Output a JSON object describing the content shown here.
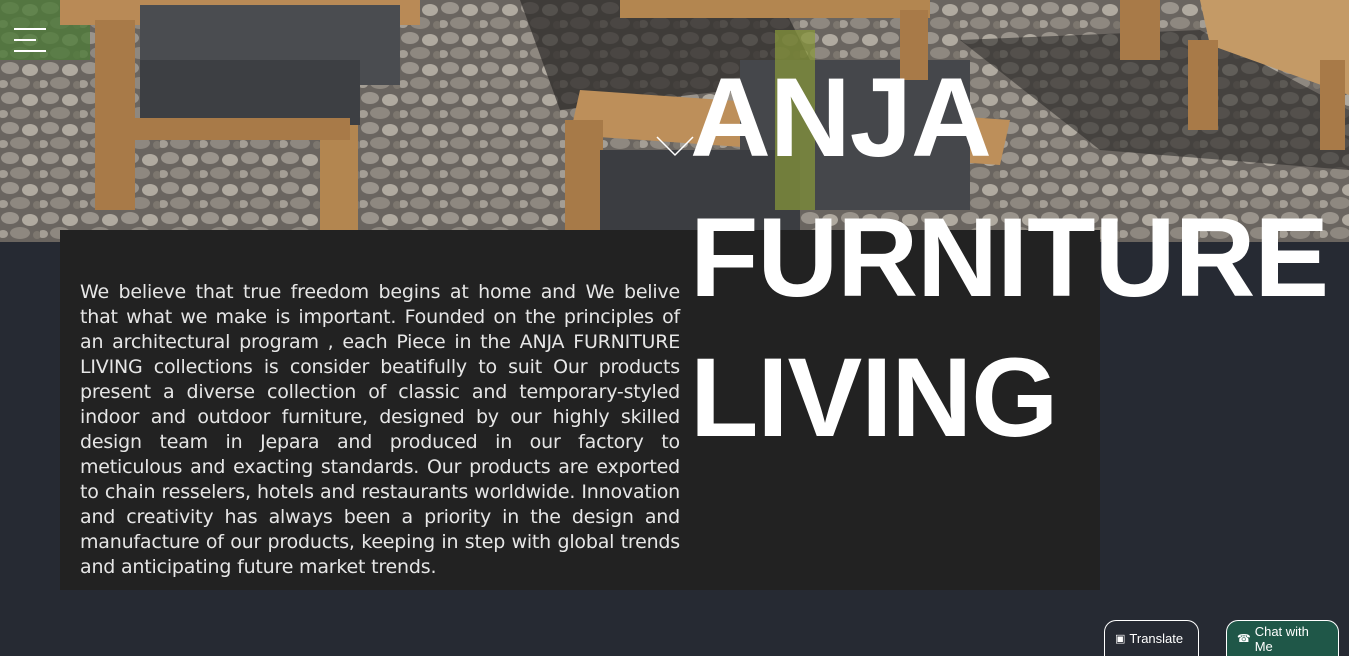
{
  "hero": {
    "title_lines": [
      "ANJA",
      "FURNITURE",
      "LIVING"
    ]
  },
  "about": {
    "text": "We believe that true freedom begins at home and We belive that what we make is important. Founded on the principles of an architectural program , each Piece in the ANJA FURNITURE LIVING collections is consider beatifully to suit Our products present a diverse collection of classic and temporary-styled indoor and outdoor furniture, designed by our highly skilled design team in Jepara and produced in our factory to meticulous and exacting standards. Our products are exported to chain resselers, hotels and restaurants worldwide. Innovation and creativity has always been a priority in the design and manufacture of our products, keeping in step with global trends and anticipating future market trends."
  },
  "floating": {
    "translate_label": "Translate",
    "chat_label": "Chat with Me"
  },
  "icons": {
    "menu": "hamburger-menu-icon",
    "scroll": "chevron-down-icon",
    "translate": "translate-icon",
    "chat": "whatsapp-icon"
  },
  "colors": {
    "page_bg": "#262a33",
    "content_bg": "#222222",
    "chat_bg": "#1f5748",
    "text": "#e6e6e6",
    "title": "#ffffff"
  }
}
